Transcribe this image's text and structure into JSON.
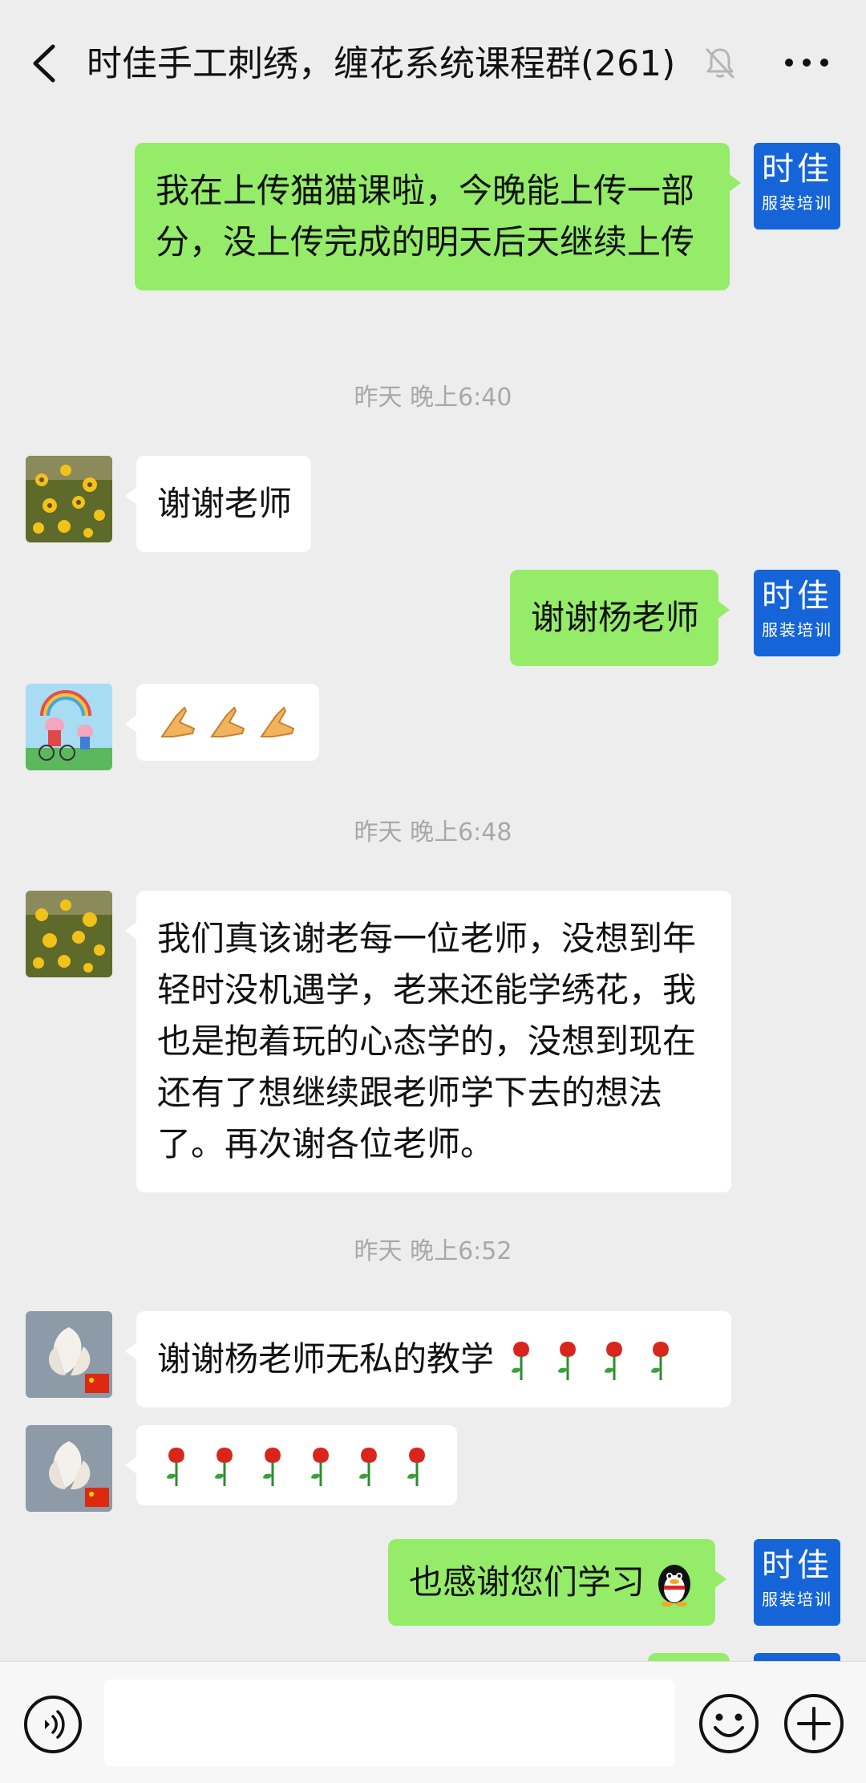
{
  "header": {
    "title": "时佳手工刺绣，缠花系统课程群(261)"
  },
  "self_avatar": {
    "line1": "时佳",
    "line2": "服装培训"
  },
  "messages": [
    {
      "text": "我在上传猫猫课啦，今晚能上传一部分，没上传完成的明天后天继续上传"
    },
    {
      "time": "昨天 晚上6:40"
    },
    {
      "text": "谢谢老师"
    },
    {
      "text": "谢谢杨老师"
    },
    {
      "emoji": "praying-hands x3"
    },
    {
      "time": "昨天 晚上6:48"
    },
    {
      "text": "我们真该谢老每一位老师，没想到年轻时没机遇学，老来还能学绣花，我也是抱着玩的心态学的，没想到现在还有了想继续跟老师学下去的想法了。再次谢各位老师。"
    },
    {
      "time": "昨天 晚上6:52"
    },
    {
      "text": "谢谢杨老师无私的教学"
    },
    {
      "emoji": "rose x6"
    },
    {
      "text": "也感谢您们学习"
    }
  ],
  "colors": {
    "self_bubble": "#95ec69",
    "other_bubble": "#ffffff",
    "background": "#ededed",
    "self_avatar": "#1565d8"
  },
  "input_bar": {
    "voice_icon": "voice-icon",
    "emoji_icon": "emoji-icon",
    "plus_icon": "plus-icon"
  }
}
